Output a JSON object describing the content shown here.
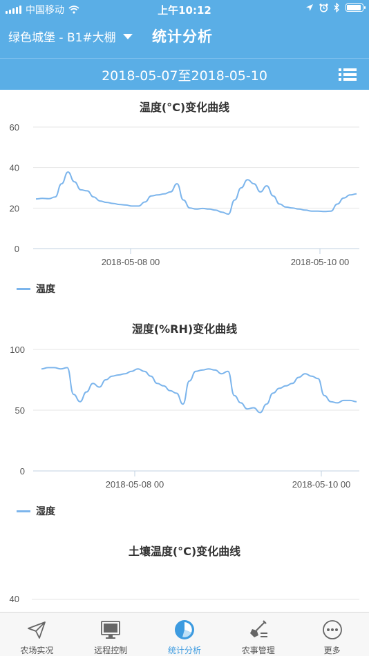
{
  "status_bar": {
    "carrier": "中国移动",
    "time": "上午10:12"
  },
  "nav": {
    "farm_selector": "绿色城堡 - B1#大棚",
    "title": "统计分析"
  },
  "date_bar": {
    "range": "2018-05-07至2018-05-10"
  },
  "charts": [
    {
      "title": "温度(°C)变化曲线",
      "legend": "温度",
      "y_ticks": [
        "0",
        "20",
        "40",
        "60"
      ],
      "x_ticks": [
        "2018-05-08 00",
        "2018-05-10 00"
      ]
    },
    {
      "title": "湿度(%RH)变化曲线",
      "legend": "湿度",
      "y_ticks": [
        "0",
        "50",
        "100"
      ],
      "x_ticks": [
        "2018-05-08 00",
        "2018-05-10 00"
      ]
    },
    {
      "title": "土壤温度(°C)变化曲线",
      "y_ticks": [
        "40"
      ]
    }
  ],
  "chart_data": [
    {
      "type": "line",
      "title": "温度(°C)变化曲线",
      "series": [
        {
          "name": "温度",
          "x": [
            0,
            0.05,
            0.1,
            0.15,
            0.2,
            0.25,
            0.3,
            0.35,
            0.4,
            0.45,
            0.5,
            0.55,
            0.6,
            0.65,
            0.7,
            0.75,
            0.8,
            0.85,
            0.9,
            0.95,
            1.0,
            1.05,
            1.1,
            1.15,
            1.2,
            1.25,
            1.3,
            1.35,
            1.4,
            1.45,
            1.5,
            1.55,
            1.6,
            1.65,
            1.7,
            1.75,
            1.8,
            1.85,
            1.9,
            1.95,
            2.0,
            2.05,
            2.1,
            2.15,
            2.2,
            2.25,
            2.3,
            2.35,
            2.4,
            2.45,
            2.5
          ],
          "values": [
            24.5,
            24.8,
            24.6,
            25.5,
            32,
            37.8,
            33,
            29,
            28.5,
            25.5,
            23.5,
            22.8,
            22.3,
            21.8,
            21.5,
            21,
            21,
            23,
            26,
            26.5,
            27,
            28,
            32,
            24,
            20,
            19.5,
            19.8,
            19.5,
            19,
            18,
            17,
            24,
            30,
            34,
            32,
            28,
            31,
            26,
            22,
            20.5,
            20,
            19.5,
            19,
            18.5,
            18.5,
            18.3,
            18.5,
            22,
            25,
            26.5,
            27
          ]
        }
      ],
      "xlabel": "",
      "ylabel": "",
      "x_ticks": [
        "2018-05-08 00",
        "2018-05-10 00"
      ],
      "ylim": [
        0,
        60
      ],
      "y_ticks": [
        0,
        20,
        40,
        60
      ]
    },
    {
      "type": "line",
      "title": "湿度(%RH)变化曲线",
      "series": [
        {
          "name": "湿度",
          "x": [
            0,
            0.05,
            0.1,
            0.15,
            0.2,
            0.25,
            0.3,
            0.35,
            0.4,
            0.45,
            0.5,
            0.55,
            0.6,
            0.65,
            0.7,
            0.75,
            0.8,
            0.85,
            0.9,
            0.95,
            1.0,
            1.05,
            1.1,
            1.15,
            1.2,
            1.25,
            1.3,
            1.35,
            1.4,
            1.45,
            1.5,
            1.55,
            1.6,
            1.65,
            1.7,
            1.75,
            1.8,
            1.85,
            1.9,
            1.95,
            2.0,
            2.05,
            2.1,
            2.15,
            2.2,
            2.25,
            2.3,
            2.35,
            2.4,
            2.45
          ],
          "values": [
            84,
            85,
            85,
            84,
            85,
            63,
            57,
            65,
            72,
            69,
            75,
            78,
            79,
            80,
            82,
            84,
            82,
            78,
            72,
            70,
            66,
            64,
            55,
            74,
            82,
            83,
            84,
            83,
            80,
            82,
            62,
            56,
            51,
            52,
            48,
            55,
            64,
            68,
            70,
            72,
            77,
            80,
            78,
            76,
            62,
            57,
            56,
            58,
            58,
            57
          ]
        }
      ],
      "xlabel": "",
      "ylabel": "",
      "x_ticks": [
        "2018-05-08 00",
        "2018-05-10 00"
      ],
      "ylim": [
        0,
        100
      ],
      "y_ticks": [
        0,
        50,
        100
      ]
    }
  ],
  "tabs": [
    {
      "label": "农场实况",
      "icon": "paper-plane-icon",
      "active": false
    },
    {
      "label": "远程控制",
      "icon": "monitor-icon",
      "active": false
    },
    {
      "label": "统计分析",
      "icon": "pie-chart-icon",
      "active": true
    },
    {
      "label": "农事管理",
      "icon": "shovel-list-icon",
      "active": false
    },
    {
      "label": "更多",
      "icon": "more-dots-icon",
      "active": false
    }
  ],
  "colors": {
    "header": "#5aaee6",
    "series": "#7cb5ec",
    "active_tab": "#3d9be0"
  }
}
